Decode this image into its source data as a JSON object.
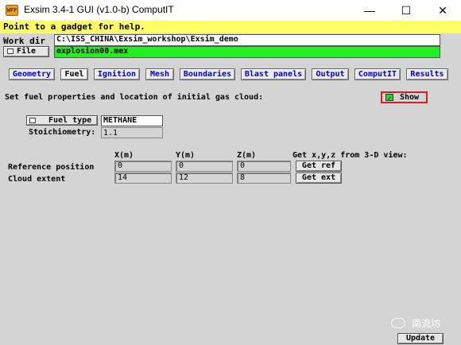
{
  "window": {
    "icon_text": "WFP",
    "title": "Exsim 3.4-1 GUI (v1.0-b) ComputIT",
    "minimize": "—",
    "maximize": "☐",
    "close": "✕"
  },
  "help": "Point to a gadget for help.",
  "workdir": {
    "label": "Work dir",
    "value": "C:\\ISS_CHINA\\Exsim_workshop\\Exsim_demo"
  },
  "file": {
    "label": "File",
    "value": "explosion00.mex"
  },
  "tabs": [
    "Geometry",
    "Fuel",
    "Ignition",
    "Mesh",
    "Boundaries",
    "Blast panels",
    "Output",
    "ComputIT",
    "Results"
  ],
  "active_tab": "Fuel",
  "fuel": {
    "heading": "Set fuel properties and location of initial gas cloud:",
    "show_label": "Show",
    "show_checked": "✓",
    "fuel_type_label": "Fuel type",
    "fuel_type_value": "METHANE",
    "stoich_label": "Stoichiometry:",
    "stoich_value": "1.1"
  },
  "coords": {
    "x_header": "X(m)",
    "y_header": "Y(m)",
    "z_header": "Z(m)",
    "get_from_3d": "Get x,y,z from 3-D view:",
    "rows": [
      {
        "label": "Reference position",
        "x": "0",
        "y": "0",
        "z": "0",
        "button": "Get ref"
      },
      {
        "label": "Cloud extent",
        "x": "14",
        "y": "12",
        "z": "8",
        "button": "Get ext"
      }
    ]
  },
  "update_button": "Update",
  "watermark": "南流坊"
}
